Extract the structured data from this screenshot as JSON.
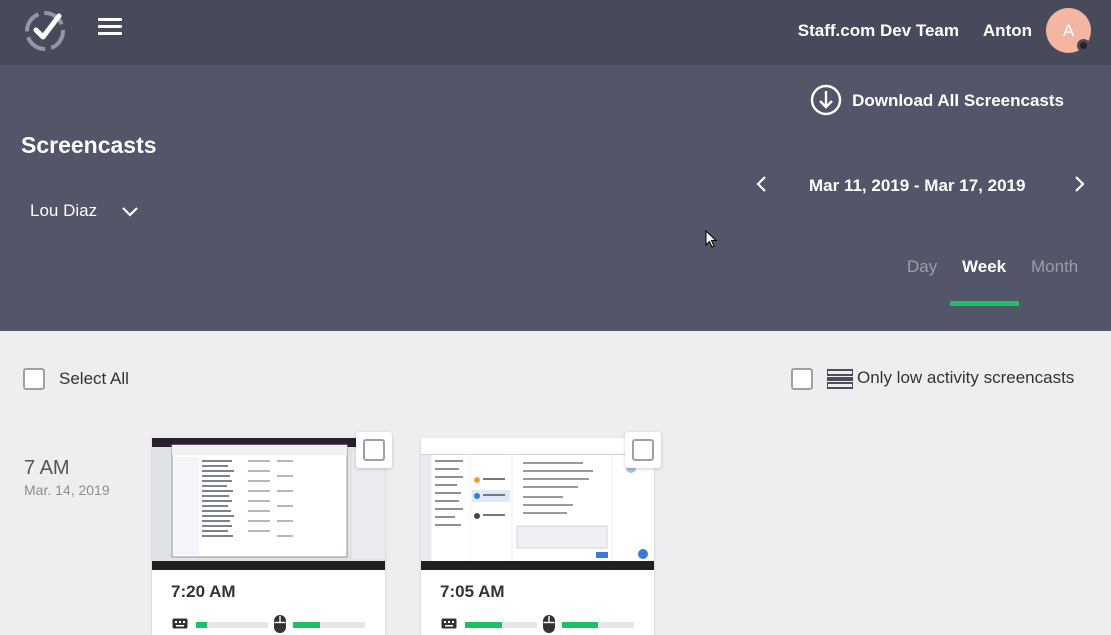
{
  "header": {
    "team": "Staff.com Dev Team",
    "user_name": "Anton",
    "avatar_letter": "A"
  },
  "panel": {
    "title": "Screencasts",
    "selected_user": "Lou Diaz",
    "download_label": "Download All Screencasts",
    "date_range": "Mar 11, 2019 - Mar 17, 2019",
    "period_tabs": [
      "Day",
      "Week",
      "Month"
    ],
    "active_period": "Week"
  },
  "filters": {
    "select_all": "Select All",
    "low_activity": "Only low activity screencasts"
  },
  "groups": [
    {
      "hour": "7 AM",
      "date": "Mar. 14, 2019",
      "cards": [
        {
          "time": "7:20 AM",
          "keyboard_activity": 0.15,
          "mouse_activity": 0.38
        },
        {
          "time": "7:05 AM",
          "keyboard_activity": 0.52,
          "mouse_activity": 0.5
        }
      ]
    }
  ],
  "colors": {
    "topbar": "#474a5a",
    "panel": "#535568",
    "accent": "#1fbf65",
    "avatar": "#f4b5a3"
  }
}
